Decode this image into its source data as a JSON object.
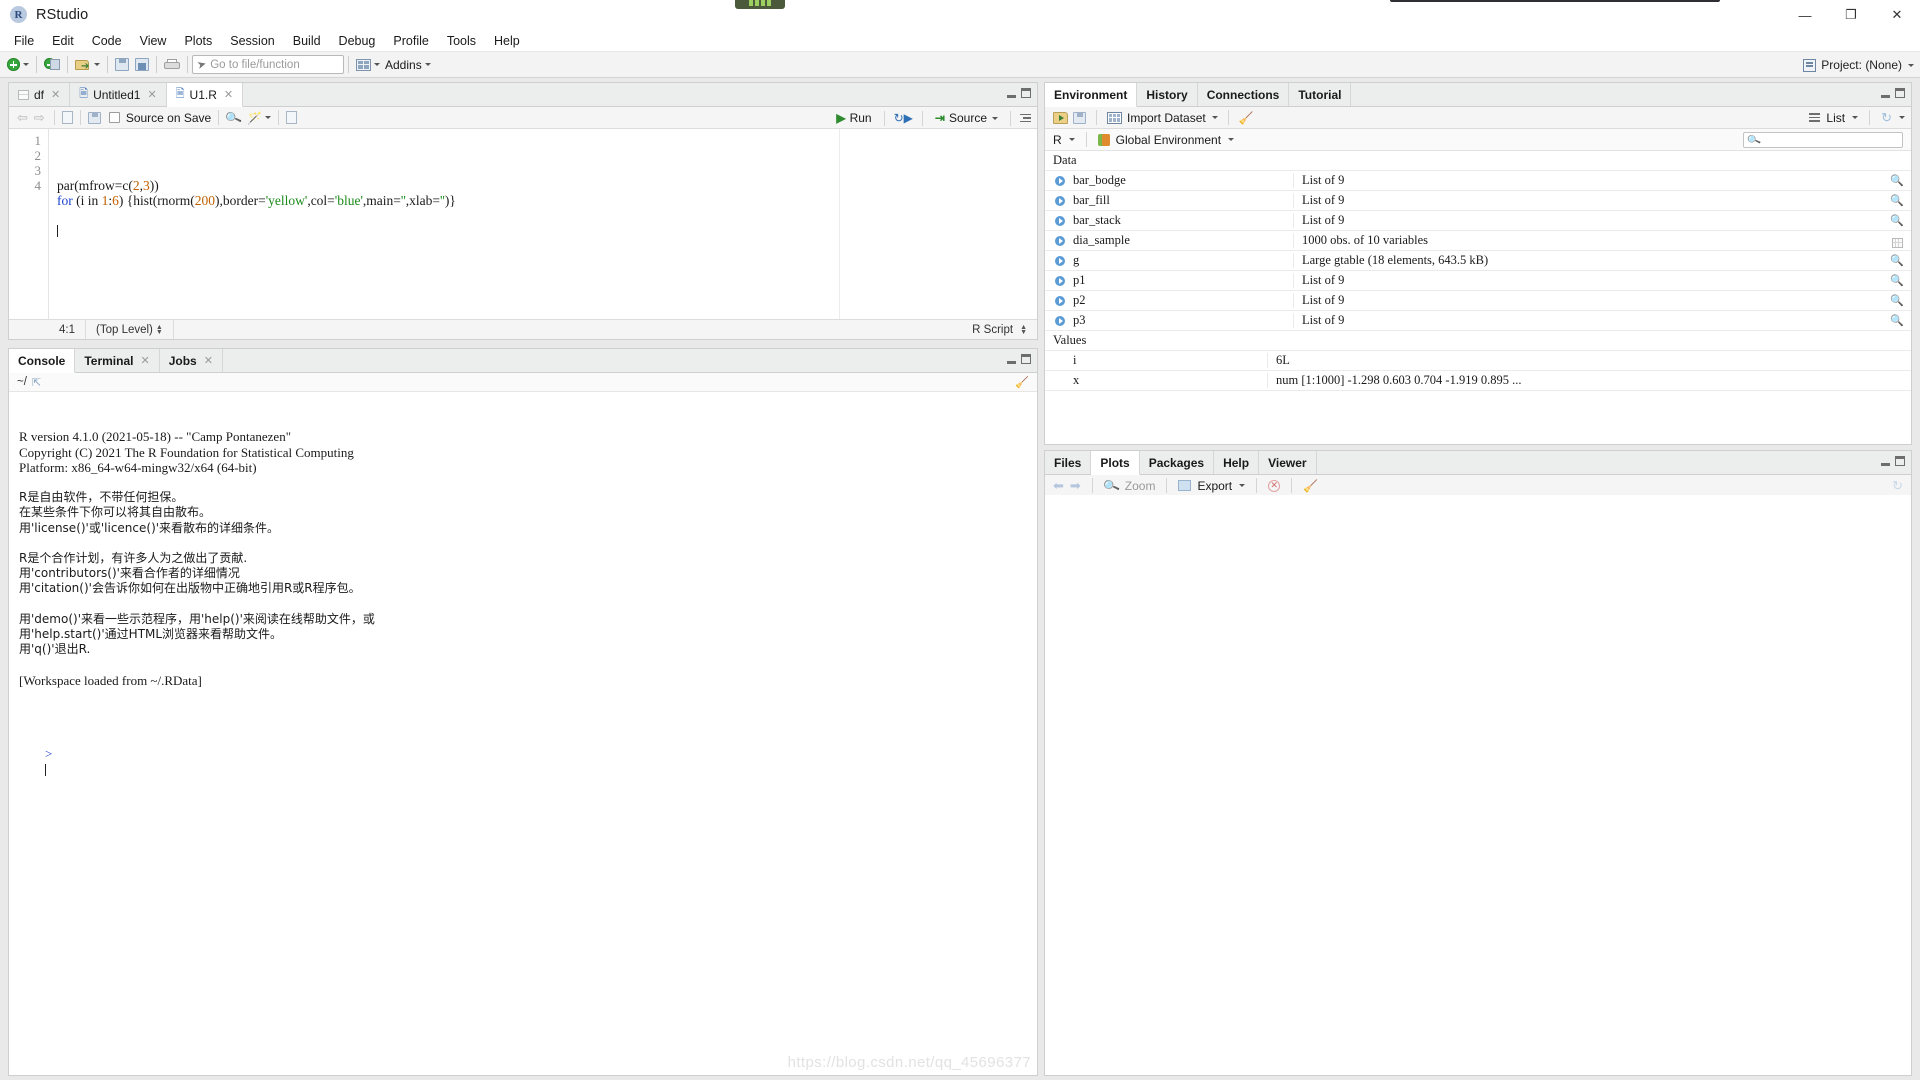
{
  "window": {
    "app_name": "RStudio",
    "app_icon": "R",
    "minimize": "—",
    "maximize": "❐",
    "close": "✕"
  },
  "menu": {
    "items": [
      {
        "label": "File"
      },
      {
        "label": "Edit"
      },
      {
        "label": "Code"
      },
      {
        "label": "View"
      },
      {
        "label": "Plots"
      },
      {
        "label": "Session"
      },
      {
        "label": "Build"
      },
      {
        "label": "Debug"
      },
      {
        "label": "Profile"
      },
      {
        "label": "Tools"
      },
      {
        "label": "Help"
      }
    ]
  },
  "toolbar": {
    "new_file_icon": "new-file-icon",
    "new_project_icon": "new-project-icon",
    "open_file_icon": "open-file-icon",
    "save_icon": "save-icon",
    "save_all_icon": "save-all-icon",
    "print_icon": "print-icon",
    "goto_placeholder": "Go to file/function",
    "addins_label": "Addins",
    "project_label": "Project: (None)"
  },
  "source": {
    "tabs": [
      {
        "label": "df",
        "icon": "table-icon",
        "closable": true,
        "active": false
      },
      {
        "label": "Untitled1",
        "icon": "r-script-icon",
        "closable": true,
        "active": false
      },
      {
        "label": "U1.R",
        "icon": "r-script-icon",
        "closable": true,
        "active": true
      }
    ],
    "toolbar": {
      "back": "⇦",
      "forward": "⇨",
      "show_doc_outline_icon": "show-in-new-window-icon",
      "save_icon": "save-icon",
      "source_on_save_label": "Source on Save",
      "find_icon": "find-replace-icon",
      "code_tools_icon": "code-tools-icon",
      "compile_report_icon": "compile-report-icon",
      "run_label": "Run",
      "rerun_icon": "rerun-icon",
      "source_label": "Source",
      "outline_icon": "document-outline-icon"
    },
    "line_numbers": [
      "1",
      "2",
      "3",
      "4"
    ],
    "code_lines": [
      {
        "number": "1",
        "tokens": [
          {
            "t": "par(mfrow=c(",
            "c": "plain"
          },
          {
            "t": "2",
            "c": "num"
          },
          {
            "t": ",",
            "c": "plain"
          },
          {
            "t": "3",
            "c": "num"
          },
          {
            "t": "))",
            "c": "plain"
          }
        ]
      },
      {
        "number": "2",
        "tokens": [
          {
            "t": "for",
            "c": "kw"
          },
          {
            "t": " (i in ",
            "c": "plain"
          },
          {
            "t": "1",
            "c": "num"
          },
          {
            "t": ":",
            "c": "plain"
          },
          {
            "t": "6",
            "c": "num"
          },
          {
            "t": ") {hist(rnorm(",
            "c": "plain"
          },
          {
            "t": "200",
            "c": "num"
          },
          {
            "t": "),border=",
            "c": "plain"
          },
          {
            "t": "'yellow'",
            "c": "str"
          },
          {
            "t": ",col=",
            "c": "plain"
          },
          {
            "t": "'blue'",
            "c": "str"
          },
          {
            "t": ",main=",
            "c": "plain"
          },
          {
            "t": "''",
            "c": "str"
          },
          {
            "t": ",xlab=",
            "c": "plain"
          },
          {
            "t": "''",
            "c": "str"
          },
          {
            "t": ")}",
            "c": "plain"
          }
        ]
      },
      {
        "number": "3",
        "tokens": []
      },
      {
        "number": "4",
        "tokens": []
      }
    ],
    "status": {
      "cursor": "4:1",
      "scope": "(Top Level)",
      "file_type": "R Script"
    }
  },
  "console": {
    "tabs": [
      {
        "label": "Console",
        "active": true,
        "closable": false
      },
      {
        "label": "Terminal",
        "active": false,
        "closable": true
      },
      {
        "label": "Jobs",
        "active": false,
        "closable": true
      }
    ],
    "working_dir": "~/",
    "clear_icon": "broom-icon",
    "output": [
      "R version 4.1.0 (2021-05-18) -- \"Camp Pontanezen\"",
      "Copyright (C) 2021 The R Foundation for Statistical Computing",
      "Platform: x86_64-w64-mingw32/x64 (64-bit)",
      "",
      "R是自由软件，不带任何担保。",
      "在某些条件下你可以将其自由散布。",
      "用'license()'或'licence()'来看散布的详细条件。",
      "",
      "R是个合作计划，有许多人为之做出了贡献.",
      "用'contributors()'来看合作者的详细情况",
      "用'citation()'会告诉你如何在出版物中正确地引用R或R程序包。",
      "",
      "用'demo()'来看一些示范程序，用'help()'来阅读在线帮助文件，或",
      "用'help.start()'通过HTML浏览器来看帮助文件。",
      "用'q()'退出R.",
      "",
      "[Workspace loaded from ~/.RData]"
    ],
    "prompt": ">",
    "watermark": "https://blog.csdn.net/qq_45696377"
  },
  "environment": {
    "tabs": [
      {
        "label": "Environment",
        "active": true
      },
      {
        "label": "History",
        "active": false
      },
      {
        "label": "Connections",
        "active": false
      },
      {
        "label": "Tutorial",
        "active": false
      }
    ],
    "toolbar": {
      "load_workspace_icon": "open-folder-icon",
      "save_workspace_icon": "save-icon",
      "import_dataset_label": "Import Dataset",
      "clear_icon": "broom-icon",
      "view_mode_label": "List",
      "refresh_icon": "refresh-icon"
    },
    "scope": {
      "language_label": "R",
      "environment_label": "Global Environment",
      "search_placeholder": ""
    },
    "groups": [
      {
        "title": "Data",
        "rows": [
          {
            "name": "bar_bodge",
            "value": "List of 9",
            "action": "search-icon",
            "expandable": true
          },
          {
            "name": "bar_fill",
            "value": "List of 9",
            "action": "search-icon",
            "expandable": true
          },
          {
            "name": "bar_stack",
            "value": "List of 9",
            "action": "search-icon",
            "expandable": true
          },
          {
            "name": "dia_sample",
            "value": "1000 obs. of 10 variables",
            "action": "grid-icon",
            "expandable": true
          },
          {
            "name": "g",
            "value": "Large gtable (18 elements,  643.5 kB)",
            "action": "search-icon",
            "expandable": true
          },
          {
            "name": "p1",
            "value": "List of 9",
            "action": "search-icon",
            "expandable": true
          },
          {
            "name": "p2",
            "value": "List of 9",
            "action": "search-icon",
            "expandable": true
          },
          {
            "name": "p3",
            "value": "List of 9",
            "action": "search-icon",
            "expandable": true
          }
        ]
      },
      {
        "title": "Values",
        "rows": [
          {
            "name": "i",
            "value": "6L",
            "action": "",
            "expandable": false
          },
          {
            "name": "x",
            "value": "num [1:1000] -1.298 0.603 0.704 -1.919 0.895 ...",
            "action": "",
            "expandable": false
          }
        ]
      }
    ]
  },
  "plots": {
    "tabs": [
      {
        "label": "Files",
        "active": false
      },
      {
        "label": "Plots",
        "active": true
      },
      {
        "label": "Packages",
        "active": false
      },
      {
        "label": "Help",
        "active": false
      },
      {
        "label": "Viewer",
        "active": false
      }
    ],
    "toolbar": {
      "back_icon": "arrow-left-icon",
      "forward_icon": "arrow-right-icon",
      "zoom_label": "Zoom",
      "export_label": "Export",
      "remove_plot_icon": "remove-plot-icon",
      "clear_all_icon": "broom-icon",
      "refresh_icon": "refresh-icon"
    }
  },
  "colors": {
    "accent_blue": "#1b3fcf",
    "string_green": "#1b8a1b",
    "number_orange": "#c06000",
    "pane_border": "#cfcfcf",
    "toolbar_bg": "#f5f5f5"
  }
}
